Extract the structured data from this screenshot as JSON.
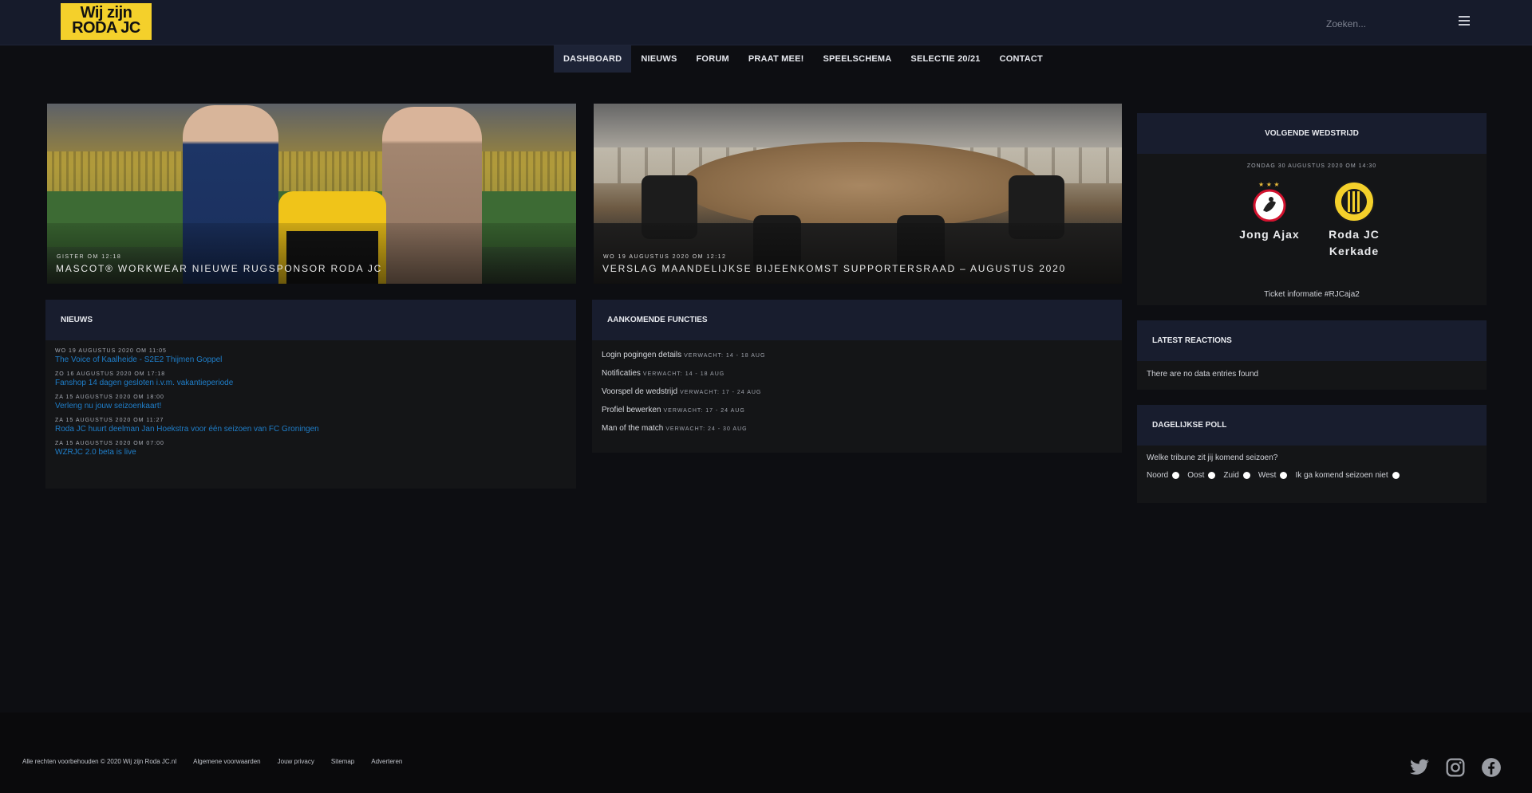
{
  "header": {
    "logo_line1": "Wij zijn",
    "logo_line2": "RODA JC",
    "search_placeholder": "Zoeken..."
  },
  "nav": [
    {
      "label": "DASHBOARD",
      "active": true
    },
    {
      "label": "NIEUWS"
    },
    {
      "label": "FORUM"
    },
    {
      "label": "PRAAT MEE!"
    },
    {
      "label": "SPEELSCHEMA"
    },
    {
      "label": "SELECTIE 20/21"
    },
    {
      "label": "CONTACT"
    }
  ],
  "heroes": [
    {
      "date": "GISTER OM 12:18",
      "title": "MASCOT® WORKWEAR NIEUWE RUGSPONSOR RODA JC"
    },
    {
      "date": "WO 19 AUGUSTUS 2020 OM 12:12",
      "title": "VERSLAG MAANDELIJKSE BIJEENKOMST SUPPORTERSRAAD – AUGUSTUS 2020"
    }
  ],
  "news": {
    "title": "NIEUWS",
    "items": [
      {
        "date": "WO 19 AUGUSTUS 2020 OM 11:05",
        "title": "The Voice of Kaalheide - S2E2 Thijmen Goppel"
      },
      {
        "date": "ZO 16 AUGUSTUS 2020 OM 17:18",
        "title": "Fanshop 14 dagen gesloten i.v.m. vakantieperiode"
      },
      {
        "date": "ZA 15 AUGUSTUS 2020 OM 18:00",
        "title": "Verleng nu jouw seizoenkaart!"
      },
      {
        "date": "ZA 15 AUGUSTUS 2020 OM 11:27",
        "title": "Roda JC huurt deelman Jan Hoekstra voor één seizoen van FC Groningen"
      },
      {
        "date": "ZA 15 AUGUSTUS 2020 OM 07:00",
        "title": "WZRJC 2.0 beta is live"
      }
    ]
  },
  "features": {
    "title": "AANKOMENDE FUNCTIES",
    "items": [
      {
        "name": "Login pogingen details",
        "expected": "VERWACHT: 14 - 18 AUG"
      },
      {
        "name": "Notificaties",
        "expected": "VERWACHT: 14 - 18 AUG"
      },
      {
        "name": "Voorspel de wedstrijd",
        "expected": "VERWACHT: 17 - 24 AUG"
      },
      {
        "name": "Profiel bewerken",
        "expected": "VERWACHT: 17 - 24 AUG"
      },
      {
        "name": "Man of the match",
        "expected": "VERWACHT: 24 - 30 AUG"
      }
    ]
  },
  "next_match": {
    "title": "VOLGENDE WEDSTRIJD",
    "date": "ZONDAG 30 AUGUSTUS 2020 OM 14:30",
    "home": "Jong Ajax",
    "away_line1": "Roda JC",
    "away_line2": "Kerkade",
    "ticket": "Ticket informatie #RJCaja2"
  },
  "reactions": {
    "title": "LATEST REACTIONS",
    "empty": "There are no data entries found"
  },
  "poll": {
    "title": "DAGELIJKSE POLL",
    "question": "Welke tribune zit jij komend seizoen?",
    "options": [
      "Noord",
      "Oost",
      "Zuid",
      "West",
      "Ik ga komend seizoen niet"
    ]
  },
  "footer": {
    "copyright": "Alle rechten voorbehouden © 2020 Wij zijn Roda JC.nl",
    "links": [
      "Algemene voorwaarden",
      "Jouw privacy",
      "Sitemap",
      "Adverteren"
    ]
  },
  "colors": {
    "header": "#161b2b",
    "panel_head": "#181d2e",
    "link": "#1f7ec9",
    "logo": "#f4d02b"
  }
}
